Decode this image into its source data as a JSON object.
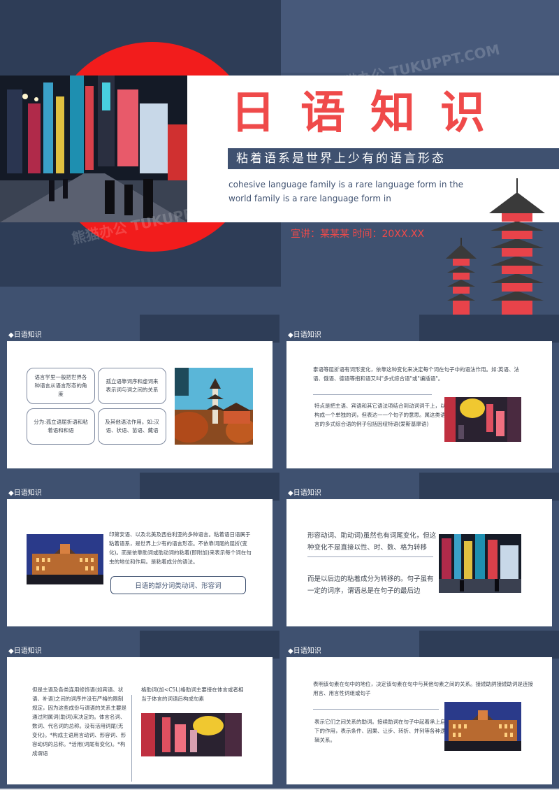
{
  "cover": {
    "title": "日语知识",
    "subtitle": "粘着语系是世界上少有的语言形态",
    "english": "cohesive language family is a rare language form in the world family is a rare language form in",
    "presenter": "宣讲：某某某 时间：20XX.XX"
  },
  "watermark": "熊猫办公 TUKUPPT.COM",
  "slides": [
    {
      "tag": "◆日语知识",
      "boxes": [
        "语言学里一般把世界各种语言从语言形态的角度",
        "孤立语靠词序和虚词来表示词与词之间的关系",
        "分为:孤立语屈折语和粘着语和和语",
        "及其他语法作用。如:汉语、状语、苗语、藏语"
      ]
    },
    {
      "tag": "◆日语知识",
      "para1": "泰语等屈折语有词形变化，依靠这种变化来决定每个词在句子中的语法作用。如:英语、法语、俄语、德语等抱和语又叫\"多式综合语\"或\"编插语\"。",
      "para2": "特点是把主语、宾语和其它语法项结合到动词词干上，以构成一个单独的词，但表达一一个句子的意思。属这类语言的多式综合语的例子包括因纽特语(爱斯基摩语)"
    },
    {
      "tag": "◆日语知识",
      "para": "印第安语、以及北美及西伯利亚的多种语言。粘着语日语属于粘着语系，是世界上少有的语言形态。不依靠词尾的屈折(变化)。而是依靠助词或助动词的粘着(即附加)来表示每个词在句虫的地位和作用。是粘着成分的语法。",
      "pill": "日语的部分词类动词、形容词"
    },
    {
      "tag": "◆日语知识",
      "para1": "形容动词、助动词)虽然也有词尾变化，但这种变化不是直接以性、时、数、格为转移",
      "para2": "而是以后边的粘着成分为转移的。句子虽有一定的词序，谓语总是在句子的最后边"
    },
    {
      "tag": "◆日语知识",
      "para1": "但是主语及各类连用修饰语(如宾语、状语、补语)之间的词序并没有严格的限制规定，因为这些成份与谓语的关系主要是通过附属词(助词)来决定的。体言名词、数词、代名词的总称。没有活用词尾(无变化)。*构成主语用言动词、形容词、形容动词的总称。*活用(词尾有变化)。*构成谓语",
      "para2": "格助词(加<C5L)格助词主要接在体言或者相当于体言的词语后构成句素"
    },
    {
      "tag": "◆日语知识",
      "para1": "表明该句素在句中的地位，决定该句素在句中与其他句素之间的关系。接続助詞接続助词是连接用言、用言性词组或句子",
      "para2": "表示它们之间关系的助词。接续助词在句子中起着承上启下的作用，表示条件、因果、让步、转折、并列等各种逻辑关系。"
    }
  ]
}
